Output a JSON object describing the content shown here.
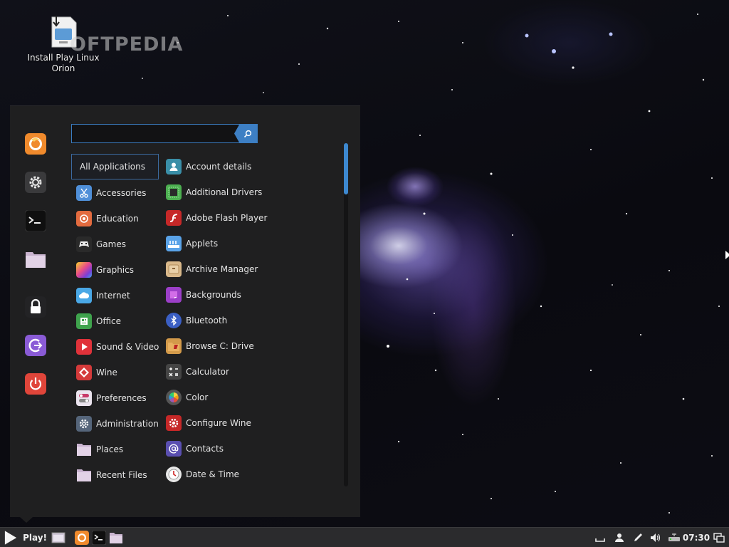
{
  "desktop": {
    "install_icon_label_line1": "Install Play Linux",
    "install_icon_label_line2": "Orion",
    "watermark_text": "OFTPEDIA"
  },
  "menu": {
    "search": {
      "value": "",
      "placeholder": ""
    },
    "favorites": [
      {
        "name": "firefox-icon",
        "color": "#f08a2c"
      },
      {
        "name": "settings-gear-icon",
        "color": "#3a3a3c"
      },
      {
        "name": "terminal-icon",
        "color": "#2a2a2a"
      },
      {
        "name": "folder-icon",
        "color": "#d8c6dc"
      },
      {
        "name": "lock-icon",
        "color": "#222"
      },
      {
        "name": "logout-icon",
        "color": "#8a5bd6"
      },
      {
        "name": "power-icon",
        "color": "#e0453a"
      }
    ],
    "categories": [
      {
        "label": "All Applications",
        "icon": "",
        "color": ""
      },
      {
        "label": "Accessories",
        "icon": "scissors-icon",
        "color": "#4f8fd8"
      },
      {
        "label": "Education",
        "icon": "education-icon",
        "color": "#e36b3f"
      },
      {
        "label": "Games",
        "icon": "gamepad-icon",
        "color": "#2a2a2a"
      },
      {
        "label": "Graphics",
        "icon": "graphics-icon",
        "color": "#c24ad0"
      },
      {
        "label": "Internet",
        "icon": "cloud-icon",
        "color": "#4aa8e6"
      },
      {
        "label": "Office",
        "icon": "office-icon",
        "color": "#3fa34d"
      },
      {
        "label": "Sound & Video",
        "icon": "play-icon",
        "color": "#e0323a"
      },
      {
        "label": "Wine",
        "icon": "wine-icon",
        "color": "#d43a3a"
      },
      {
        "label": "Preferences",
        "icon": "toggle-icon",
        "color": "#e6e0ea"
      },
      {
        "label": "Administration",
        "icon": "gear-icon",
        "color": "#55657a"
      },
      {
        "label": "Places",
        "icon": "folder-icon",
        "color": "#dccbe0"
      },
      {
        "label": "Recent Files",
        "icon": "folder-icon",
        "color": "#dccbe0"
      }
    ],
    "apps": [
      {
        "label": "Account details",
        "icon": "user-icon",
        "color": "#3a8fa8"
      },
      {
        "label": "Additional Drivers",
        "icon": "chip-icon",
        "color": "#4caf50"
      },
      {
        "label": "Adobe Flash Player",
        "icon": "flash-icon",
        "color": "#c62828"
      },
      {
        "label": "Applets",
        "icon": "applets-icon",
        "color": "#5aa3e8"
      },
      {
        "label": "Archive Manager",
        "icon": "archive-icon",
        "color": "#d9b88a"
      },
      {
        "label": "Backgrounds",
        "icon": "backgrounds-icon",
        "color": "#9c3fc8"
      },
      {
        "label": "Bluetooth",
        "icon": "bluetooth-icon",
        "color": "#3b5fc4"
      },
      {
        "label": "Browse C: Drive",
        "icon": "drive-icon",
        "color": "#d39a4a"
      },
      {
        "label": "Calculator",
        "icon": "calculator-icon",
        "color": "#444"
      },
      {
        "label": "Color",
        "icon": "color-wheel-icon",
        "color": "#888"
      },
      {
        "label": "Configure Wine",
        "icon": "wine-config-icon",
        "color": "#c62828"
      },
      {
        "label": "Contacts",
        "icon": "at-icon",
        "color": "#5a4fb0"
      },
      {
        "label": "Date & Time",
        "icon": "clock-icon",
        "color": "#e8e8e8"
      }
    ]
  },
  "panel": {
    "menu_button_label": "Play!",
    "clock": "07:30"
  }
}
